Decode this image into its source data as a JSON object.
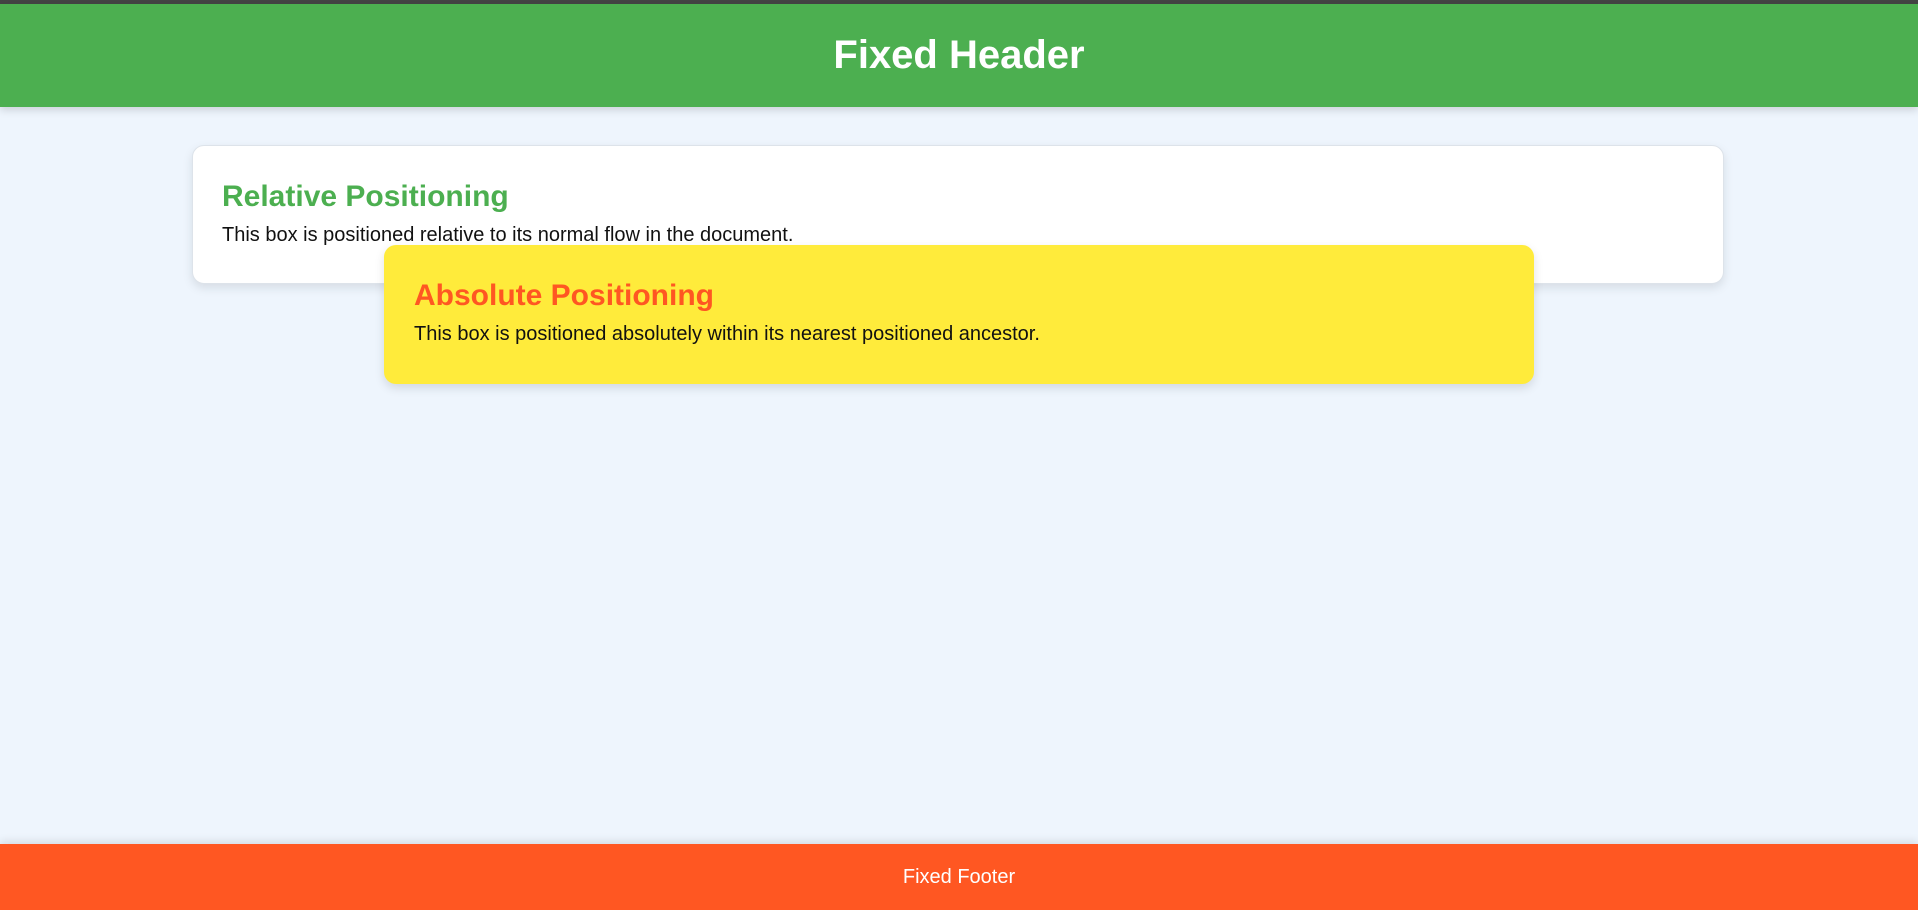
{
  "header": {
    "title": "Fixed Header"
  },
  "relative_box": {
    "title": "Relative Positioning",
    "text": "This box is positioned relative to its normal flow in the document."
  },
  "absolute_box": {
    "title": "Absolute Positioning",
    "text": "This box is positioned absolutely within its nearest positioned ancestor."
  },
  "footer": {
    "text": "Fixed Footer"
  },
  "colors": {
    "header_bg": "#4caf50",
    "page_bg": "#eef5fd",
    "relative_title": "#4caf50",
    "absolute_bg": "#ffeb3b",
    "absolute_title": "#ff5722",
    "footer_bg": "#ff5722"
  }
}
